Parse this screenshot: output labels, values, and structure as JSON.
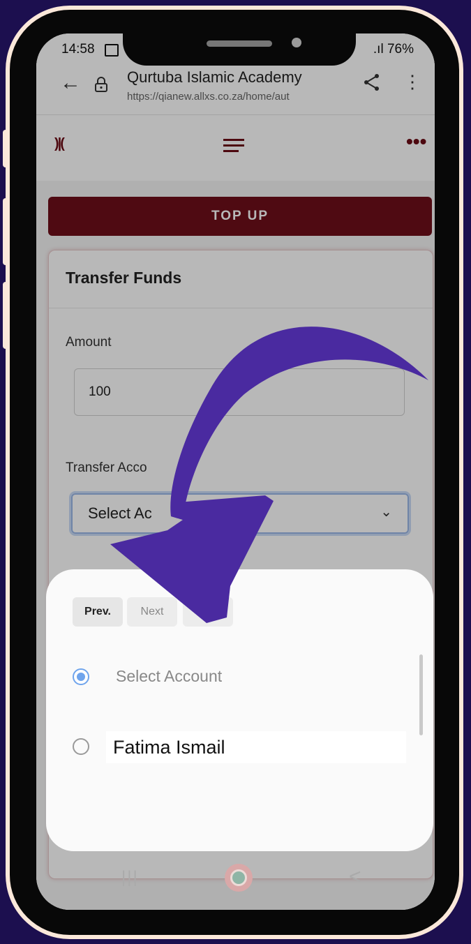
{
  "status_bar": {
    "time": "14:58",
    "signal_battery": ".ıl 76%"
  },
  "browser": {
    "page_title": "Qurtuba Islamic Academy",
    "url": "https://qianew.allxs.co.za/home/aut"
  },
  "app": {
    "top_up_label": "TOP UP",
    "card": {
      "title": "Transfer Funds",
      "amount_label": "Amount",
      "amount_value": "100",
      "transfer_label": "Transfer Acco",
      "select_value": "Select Ac"
    }
  },
  "picker": {
    "prev_label": "Prev.",
    "next_label": "Next",
    "options": [
      {
        "label": "Select Account",
        "selected": true
      },
      {
        "label": "Fatima Ismail",
        "selected": false
      }
    ]
  },
  "nav": {
    "recents_glyph": "|||",
    "back_glyph": "<"
  },
  "colors": {
    "background": "#1c0f4f",
    "phone_frame": "#fbe8da",
    "brand": "#6e0e19",
    "arrow": "#4a2aa0",
    "radio_accent": "#6fa4ec"
  }
}
